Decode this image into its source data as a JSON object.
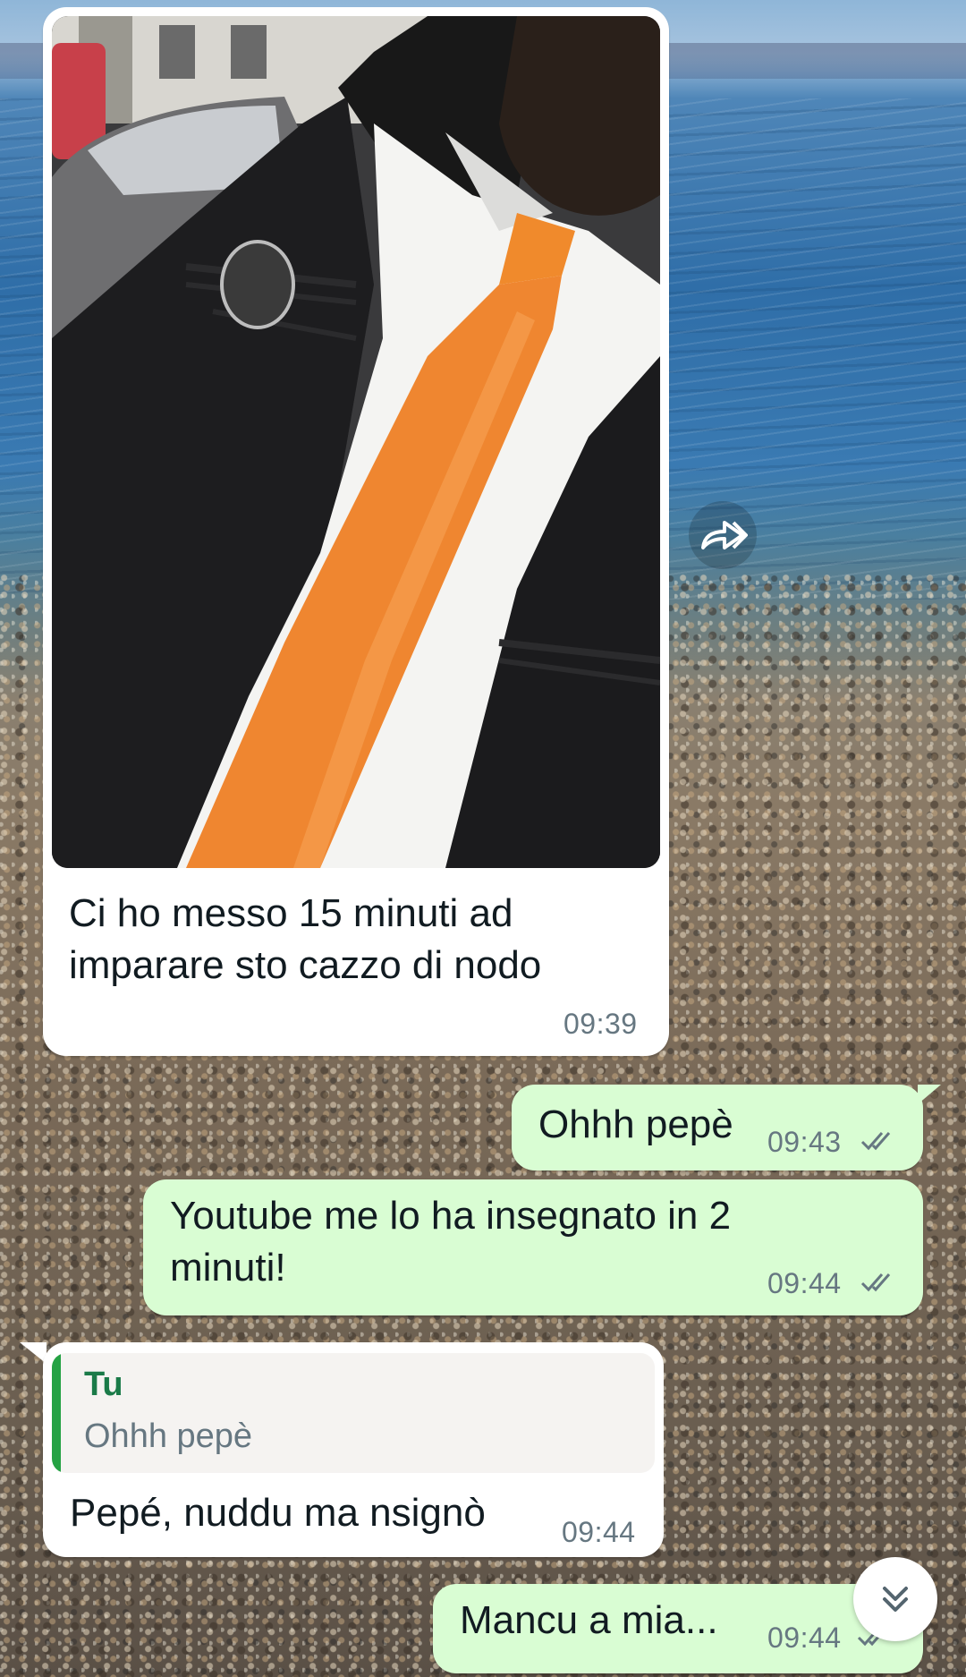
{
  "chat": {
    "messages": [
      {
        "direction": "incoming",
        "type": "image",
        "caption": [
          "Ci ho messo 15 minuti ad",
          "imparare sto cazzo di nodo"
        ],
        "time": "09:39"
      },
      {
        "direction": "outgoing",
        "text": "Ohhh pepè",
        "time": "09:43",
        "status": "read"
      },
      {
        "direction": "outgoing",
        "text": [
          "Youtube me lo ha insegnato in 2",
          "minuti!"
        ],
        "time": "09:44",
        "status": "read"
      },
      {
        "direction": "incoming",
        "quote": {
          "author": "Tu",
          "text": "Ohhh pepè"
        },
        "text": "Pepé, nuddu ma nsignò",
        "time": "09:44"
      },
      {
        "direction": "outgoing",
        "text": "Mancu a mia...",
        "time": "09:44",
        "status": "read"
      }
    ]
  },
  "icons": {
    "forward": "forward-icon",
    "scroll_down": "double-chevron-down-icon",
    "read_receipt": "double-check-icon"
  },
  "colors": {
    "incoming_bubble": "#ffffff",
    "outgoing_bubble": "#d9fdd3",
    "quote_accent": "#25a244",
    "quote_author": "#1a7a48",
    "time_text": "#667781"
  }
}
